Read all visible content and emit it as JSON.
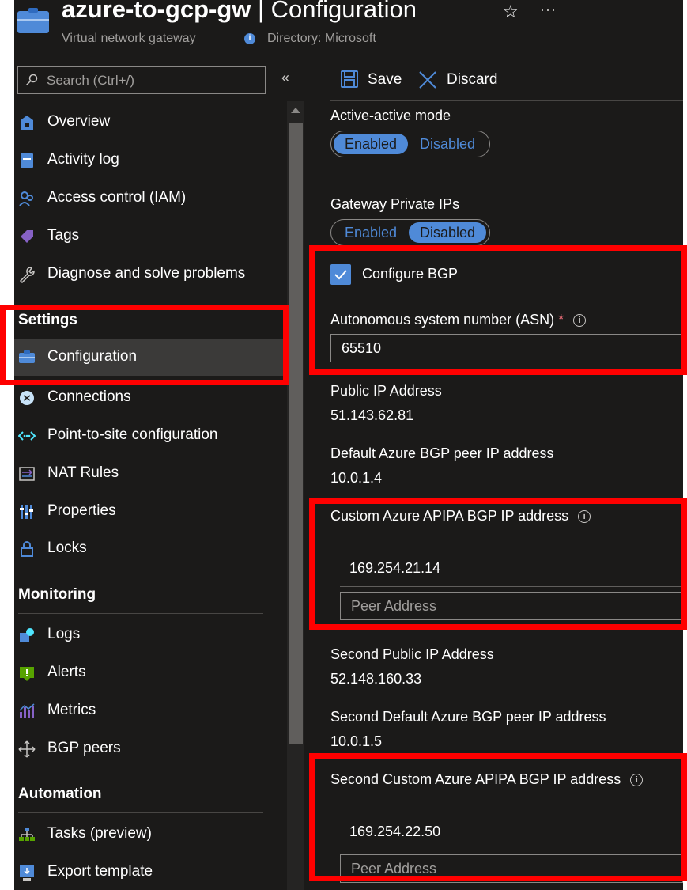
{
  "header": {
    "title_bold": "azure-to-gcp-gw",
    "title_rest": " | Configuration",
    "subtitle": "Virtual network gateway",
    "directory": "Directory: Microsoft",
    "star_glyph": "☆",
    "more_glyph": "···",
    "info_glyph": "i"
  },
  "search": {
    "placeholder": "Search (Ctrl+/)"
  },
  "collapse_glyph": "«",
  "nav": {
    "items": [
      {
        "label": "Overview",
        "icon": "overview-icon"
      },
      {
        "label": "Activity log",
        "icon": "activity-log-icon"
      },
      {
        "label": "Access control (IAM)",
        "icon": "iam-icon"
      },
      {
        "label": "Tags",
        "icon": "tag-icon"
      },
      {
        "label": "Diagnose and solve problems",
        "icon": "wrench-icon"
      }
    ],
    "settings_heading": "Settings",
    "settings_items": [
      {
        "label": "Configuration",
        "icon": "configuration-icon",
        "selected": true
      },
      {
        "label": "Connections",
        "icon": "connections-icon"
      },
      {
        "label": "Point-to-site configuration",
        "icon": "point-to-site-icon"
      },
      {
        "label": "NAT Rules",
        "icon": "nat-rules-icon"
      },
      {
        "label": "Properties",
        "icon": "properties-icon"
      },
      {
        "label": "Locks",
        "icon": "lock-icon"
      }
    ],
    "monitoring_heading": "Monitoring",
    "monitoring_items": [
      {
        "label": "Logs",
        "icon": "logs-icon"
      },
      {
        "label": "Alerts",
        "icon": "alerts-icon"
      },
      {
        "label": "Metrics",
        "icon": "metrics-icon"
      },
      {
        "label": "BGP peers",
        "icon": "bgp-peers-icon"
      }
    ],
    "automation_heading": "Automation",
    "automation_items": [
      {
        "label": "Tasks (preview)",
        "icon": "tasks-icon"
      },
      {
        "label": "Export template",
        "icon": "export-template-icon"
      }
    ]
  },
  "toolbar": {
    "save_label": "Save",
    "discard_label": "Discard"
  },
  "form": {
    "active_active_label": "Active-active mode",
    "active_active_options": [
      "Enabled",
      "Disabled"
    ],
    "active_active_selected": "Enabled",
    "private_ips_label": "Gateway Private IPs",
    "private_ips_options": [
      "Enabled",
      "Disabled"
    ],
    "private_ips_selected": "Disabled",
    "configure_bgp_label": "Configure BGP",
    "configure_bgp_checked": true,
    "checkmark_glyph": "✓",
    "asn_label": "Autonomous system number (ASN)",
    "required_mark": "*",
    "asn_value": "65510",
    "public_ip_label": "Public IP Address",
    "public_ip_value": "51.143.62.81",
    "default_bgp_peer_label": "Default Azure BGP peer IP address",
    "default_bgp_peer_value": "10.0.1.4",
    "custom_apipa_label": "Custom Azure APIPA BGP IP address",
    "custom_apipa_value": "169.254.21.14",
    "custom_apipa_placeholder": "Peer Address",
    "second_public_ip_label": "Second Public IP Address",
    "second_public_ip_value": "52.148.160.33",
    "second_default_bgp_peer_label": "Second Default Azure BGP peer IP address",
    "second_default_bgp_peer_value": "10.0.1.5",
    "second_custom_apipa_label": "Second Custom Azure APIPA BGP IP address",
    "second_custom_apipa_value": "169.254.22.50",
    "second_custom_apipa_placeholder": "Peer Address"
  },
  "colors": {
    "background": "#1b1a19",
    "accent": "#4f8ad8",
    "highlight": "#ff0000",
    "selected_nav": "#3b3a39"
  }
}
